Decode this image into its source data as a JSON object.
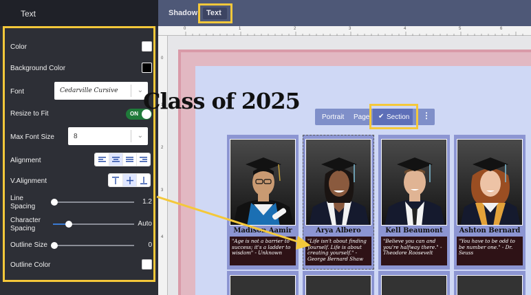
{
  "panel": {
    "title": "Text",
    "color_label": "Color",
    "color_value": "#ffffff",
    "bg_color_label": "Background Color",
    "bg_color_value": "#000000",
    "font_label": "Font",
    "font_value": "Cedarville Cursive",
    "resize_label": "Resize to Fit",
    "resize_toggle": "ON",
    "max_font_label": "Max Font Size",
    "max_font_value": "8",
    "alignment_label": "Alignment",
    "valignment_label": "V.Alignment",
    "line_spacing_label": "Line\nSpacing",
    "line_spacing_value": "1.2",
    "char_spacing_label": "Character\nSpacing",
    "char_spacing_value": "Auto",
    "outline_size_label": "Outline Size",
    "outline_size_value": "0",
    "outline_color_label": "Outline Color",
    "outline_color_value": "#ffffff"
  },
  "topbar": {
    "tabs": [
      "Shadow",
      "Text"
    ],
    "active_tab": "Text"
  },
  "ruler": {
    "h_ticks": [
      "0",
      "1",
      "2",
      "3",
      "4",
      "5",
      "6",
      "7"
    ],
    "v_ticks": [
      "0",
      "1",
      "2",
      "3",
      "4"
    ]
  },
  "page": {
    "title": "Class of 2025",
    "floatbar": {
      "items": [
        "Portrait",
        "Page",
        "Section"
      ],
      "selected": "Section",
      "more_label": "⋮"
    },
    "students": [
      {
        "name": "Madison Aamir",
        "quote": "\"Age is not a barrier to success; it's a ladder to wisdom\" - Unknown"
      },
      {
        "name": "Arya Albero",
        "quote": "\"Life isn't about finding yourself. Life is about creating yourself.\" - George Bernard Shaw"
      },
      {
        "name": "Kell Beaumont",
        "quote": "\"Believe you can and you're halfway there.\" - Theodore Roosevelt"
      },
      {
        "name": "Ashton Bernard",
        "quote": "\"You have to be odd to be number one.\" - Dr. Seuss"
      }
    ]
  },
  "colors": {
    "highlight": "#f4c83a",
    "topbar": "#4e5877",
    "card": "#8c95d2",
    "quote_bg": "#2e1216",
    "toggle_on": "#1f7a3a"
  }
}
